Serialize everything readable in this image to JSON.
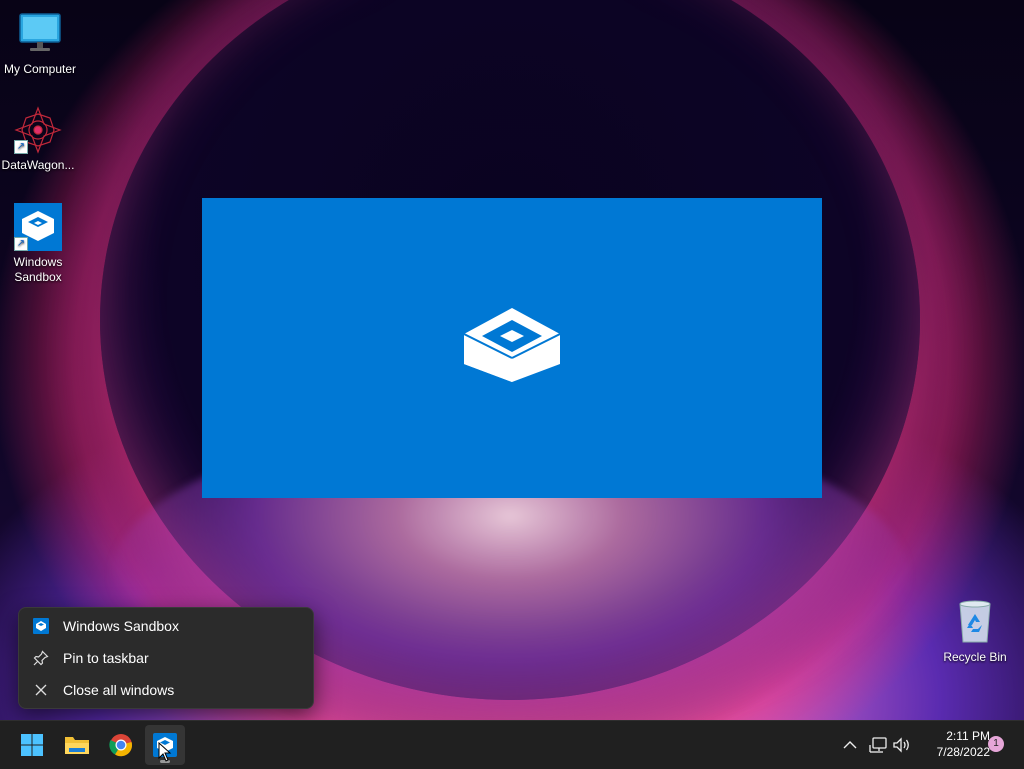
{
  "desktop": {
    "icons": [
      {
        "label": "My Computer",
        "icon": "monitor-icon"
      },
      {
        "label": "DataWagon...",
        "icon": "datawagon-logo-icon"
      },
      {
        "label": "Windows\nSandbox",
        "icon": "sandbox-icon"
      },
      {
        "label": "Recycle Bin",
        "icon": "recycle-bin-icon"
      }
    ]
  },
  "splash": {
    "app": "Windows Sandbox",
    "color": "#0078d4",
    "icon": "sandbox-logo-icon"
  },
  "context_menu": {
    "items": [
      {
        "label": "Windows Sandbox",
        "icon": "sandbox-icon"
      },
      {
        "label": "Pin to taskbar",
        "icon": "pin-icon"
      },
      {
        "label": "Close all windows",
        "icon": "close-icon"
      }
    ]
  },
  "taskbar": {
    "apps": [
      {
        "name": "start",
        "icon": "windows-start-icon"
      },
      {
        "name": "file-explorer",
        "icon": "folder-icon"
      },
      {
        "name": "chrome",
        "icon": "chrome-icon"
      },
      {
        "name": "windows-sandbox",
        "icon": "sandbox-icon",
        "active": true
      }
    ],
    "tray": {
      "time": "2:11 PM",
      "date": "7/28/2022",
      "notification_count": "1",
      "icons": [
        "chevron-up-icon",
        "network-icon",
        "volume-icon"
      ]
    }
  },
  "colors": {
    "accent": "#0078d4",
    "taskbar": "#202020",
    "menu": "#2b2b2b"
  }
}
